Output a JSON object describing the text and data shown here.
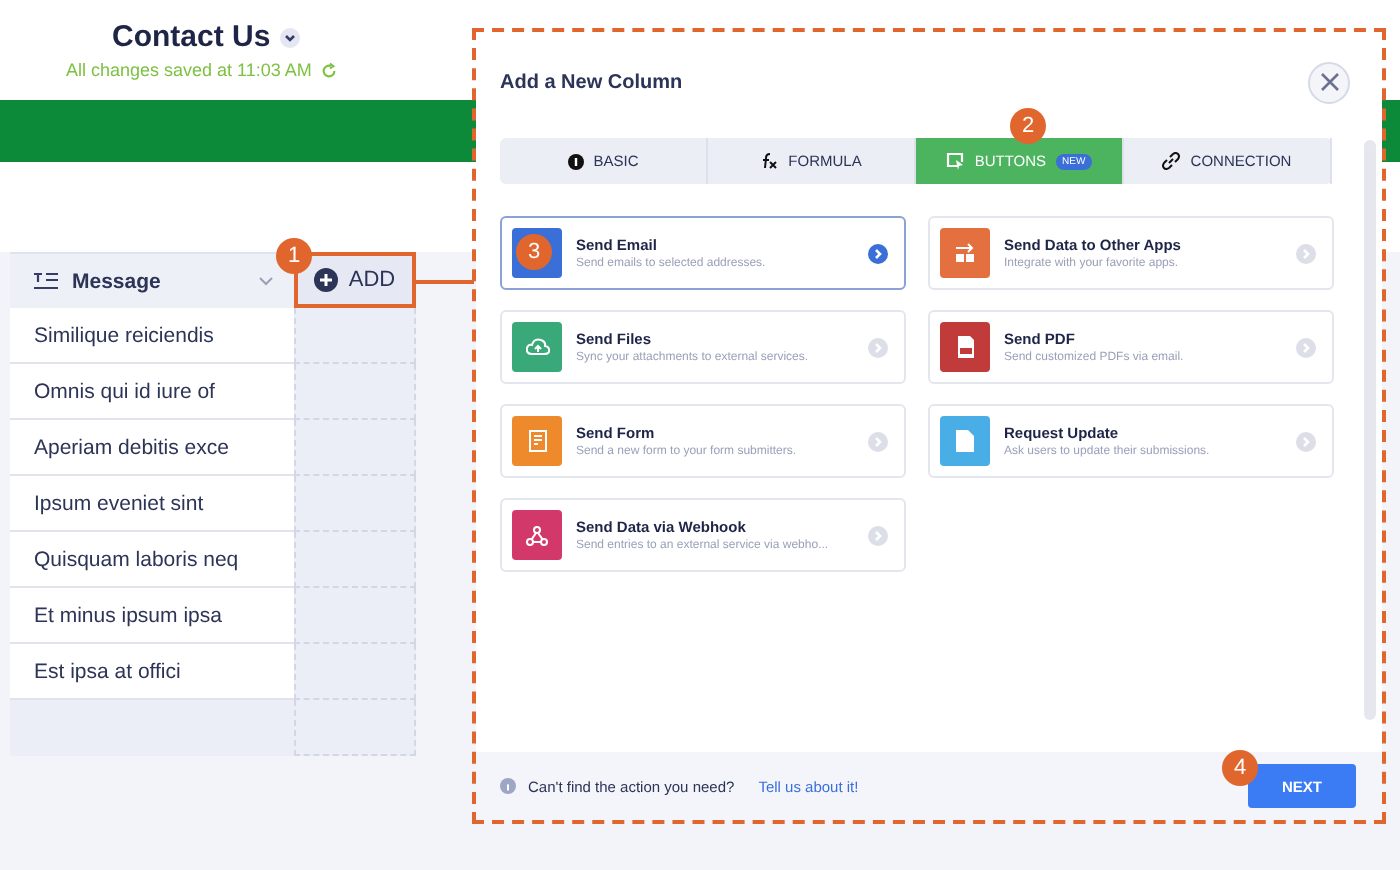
{
  "form": {
    "title": "Contact Us",
    "save_status": "All changes saved at 11:03 AM"
  },
  "table": {
    "column": "Message",
    "add_label": "ADD",
    "rows": [
      "Similique reiciendis",
      "Omnis qui id iure of",
      "Aperiam debitis exce",
      "Ipsum eveniet sint",
      "Quisquam laboris neq",
      "Et minus ipsum ipsa",
      "Est ipsa at offici"
    ]
  },
  "modal": {
    "title": "Add a New Column",
    "tabs": [
      {
        "label": "BASIC",
        "selected": false
      },
      {
        "label": "FORMULA",
        "selected": false
      },
      {
        "label": "BUTTONS",
        "selected": true,
        "badge": "NEW"
      },
      {
        "label": "CONNECTION",
        "selected": false
      }
    ],
    "actions": [
      {
        "title": "Send Email",
        "description": "Send emails to selected addresses.",
        "color": "#3b6fd8",
        "selected": true
      },
      {
        "title": "Send Data to Other Apps",
        "description": "Integrate with your favorite apps.",
        "color": "#e4703f",
        "selected": false
      },
      {
        "title": "Send Files",
        "description": "Sync your attachments to external services.",
        "color": "#3aa97a",
        "selected": false
      },
      {
        "title": "Send PDF",
        "description": "Send customized PDFs via email.",
        "color": "#c23b3b",
        "selected": false
      },
      {
        "title": "Send Form",
        "description": "Send a new form to your form submitters.",
        "color": "#ef8a2c",
        "selected": false
      },
      {
        "title": "Request Update",
        "description": "Ask users to update their submissions.",
        "color": "#4aaee6",
        "selected": false
      },
      {
        "title": "Send Data via Webhook",
        "description": "Send entries to an external service via webho...",
        "color": "#d2386a",
        "selected": false
      }
    ],
    "footer_text": "Can't find the action you need?",
    "footer_link": "Tell us about it!",
    "next_label": "NEXT"
  },
  "steps": [
    "1",
    "2",
    "3",
    "4"
  ]
}
